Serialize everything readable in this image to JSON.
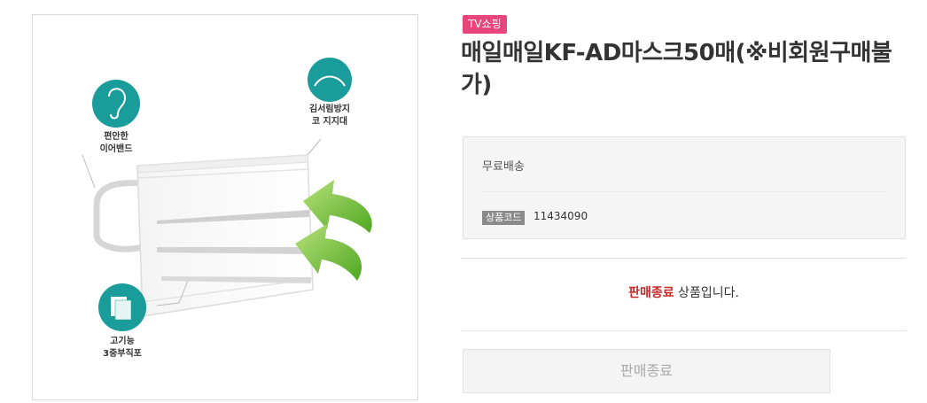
{
  "product": {
    "badge": "TV쇼핑",
    "title": "매일매일KF-AD마스크50매(※비회원구매불가)",
    "image": {
      "features": [
        {
          "label": "편안한\n이어밴드",
          "icon": "ear-icon"
        },
        {
          "label": "김서림방지\n코 지지대",
          "icon": "nose-bridge-icon"
        },
        {
          "label": "고기능\n3중부직포",
          "icon": "layers-icon"
        }
      ]
    },
    "shipping": "무료배송",
    "code_label": "상품코드",
    "code_value": "11434090",
    "status_highlight": "판매종료",
    "status_rest": " 상품입니다.",
    "button_label": "판매종료",
    "colors": {
      "badge": "#e8457a",
      "icon_teal": "#1a9c9a",
      "status_red": "#c62828",
      "arrow_green": "#7dc23a"
    }
  }
}
